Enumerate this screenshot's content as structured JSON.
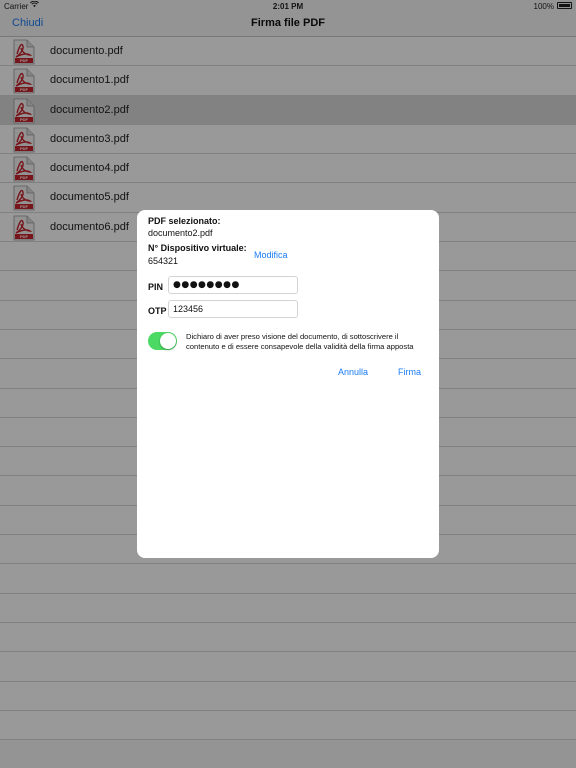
{
  "status": {
    "carrier": "Carrier",
    "time": "2:01 PM",
    "battery": "100%"
  },
  "nav": {
    "close": "Chiudi",
    "title": "Firma file PDF"
  },
  "files": [
    {
      "name": "documento.pdf",
      "selected": false
    },
    {
      "name": "documento1.pdf",
      "selected": false
    },
    {
      "name": "documento2.pdf",
      "selected": true
    },
    {
      "name": "documento3.pdf",
      "selected": false
    },
    {
      "name": "documento4.pdf",
      "selected": false
    },
    {
      "name": "documento5.pdf",
      "selected": false
    },
    {
      "name": "documento6.pdf",
      "selected": false
    }
  ],
  "dialog": {
    "selected_title": "PDF selezionato:",
    "selected_value": "documento2.pdf",
    "device_title": "N° Dispositivo virtuale:",
    "device_value": "654321",
    "modify": "Modifica",
    "pin_label": "PIN",
    "pin_value": "●●●●●●●●",
    "otp_label": "OTP",
    "otp_value": "123456",
    "toggle_on": true,
    "declaration": "Dichiaro di aver preso visione del documento, di sottoscrivere il contenuto e di essere consapevole della validità della firma apposta",
    "cancel": "Annulla",
    "sign": "Firma"
  },
  "colors": {
    "accent": "#1a7cf5",
    "toggle": "#4cd964",
    "pdf_red": "#c8232c"
  },
  "icons": {
    "file": "pdf-file-icon",
    "wifi": "wifi-icon",
    "battery": "battery-icon"
  }
}
